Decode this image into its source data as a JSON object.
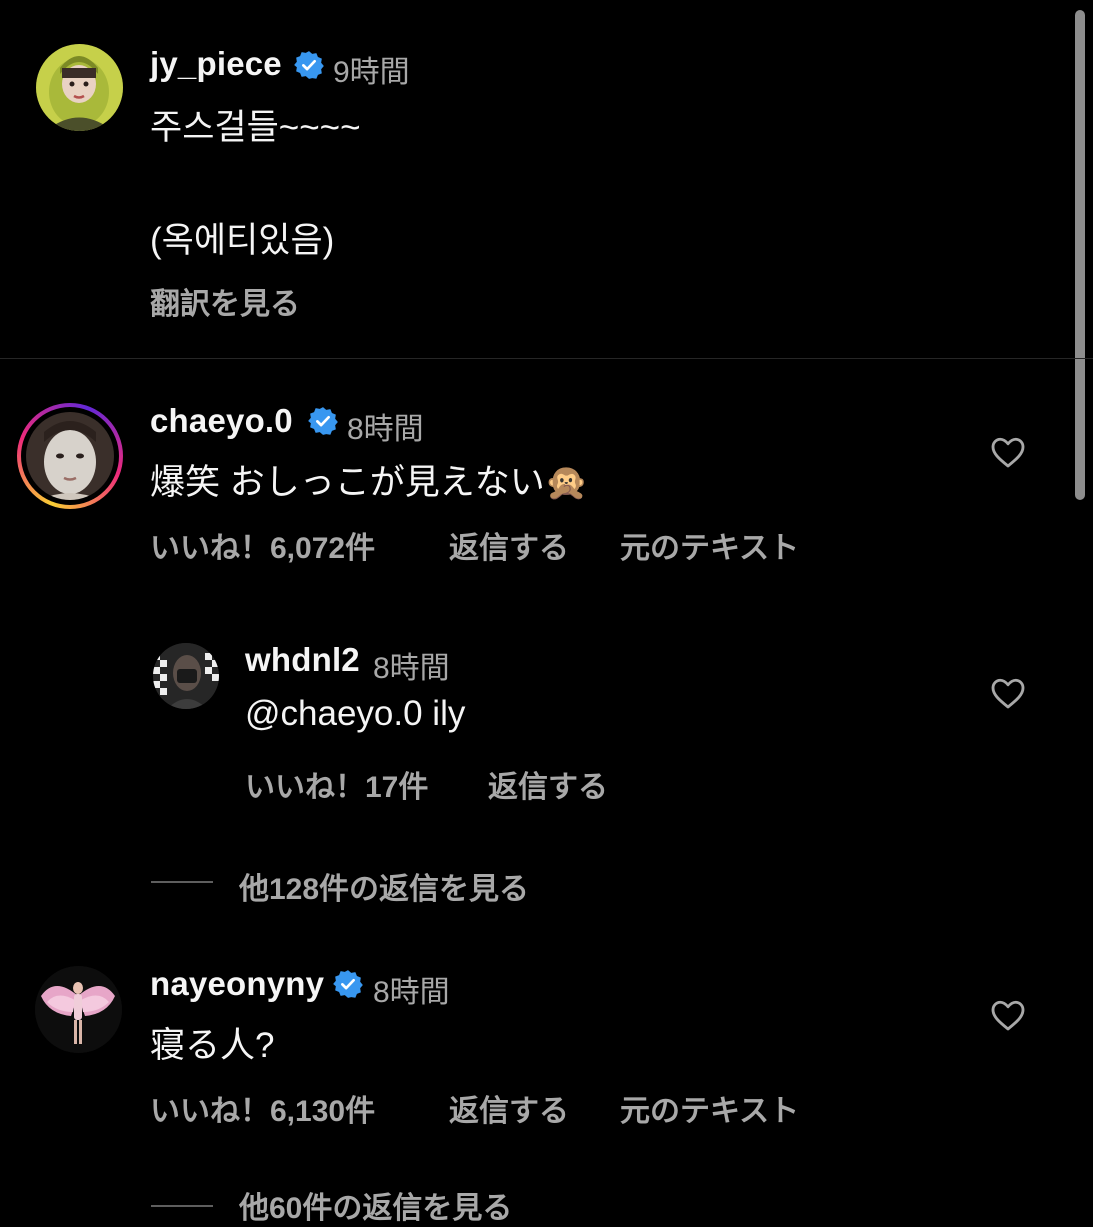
{
  "caption": {
    "username": "jy_piece",
    "verified": true,
    "time": "9時間",
    "text_line1": "주스걸들~~~~",
    "text_line2": "(옥에티있음)",
    "translate_label": "翻訳を見る"
  },
  "comments": [
    {
      "username": "chaeyo.0",
      "verified": true,
      "time": "8時間",
      "text": "爆笑 おしっこが見えない🙊",
      "likes": "いいね！6,072件",
      "reply_label": "返信する",
      "original_label": "元のテキスト",
      "replies": [
        {
          "username": "whdnl2",
          "time": "8時間",
          "text": "@chaeyo.0 ily",
          "likes": "いいね！17件",
          "reply_label": "返信する"
        }
      ],
      "view_more_replies": "他128件の返信を見る"
    },
    {
      "username": "nayeonyny",
      "verified": true,
      "time": "8時間",
      "text": "寝る人?",
      "likes": "いいね！6,130件",
      "reply_label": "返信する",
      "original_label": "元のテキスト",
      "view_more_replies": "他60件の返信を見る"
    }
  ],
  "colors": {
    "background": "#000000",
    "primary_text": "#f5f5f5",
    "secondary_text": "#a8a8a8",
    "verified_blue": "#3897f0",
    "story_ring_start": "#f9ce34",
    "story_ring_mid": "#ee2a7b",
    "story_ring_end": "#6228d7"
  }
}
